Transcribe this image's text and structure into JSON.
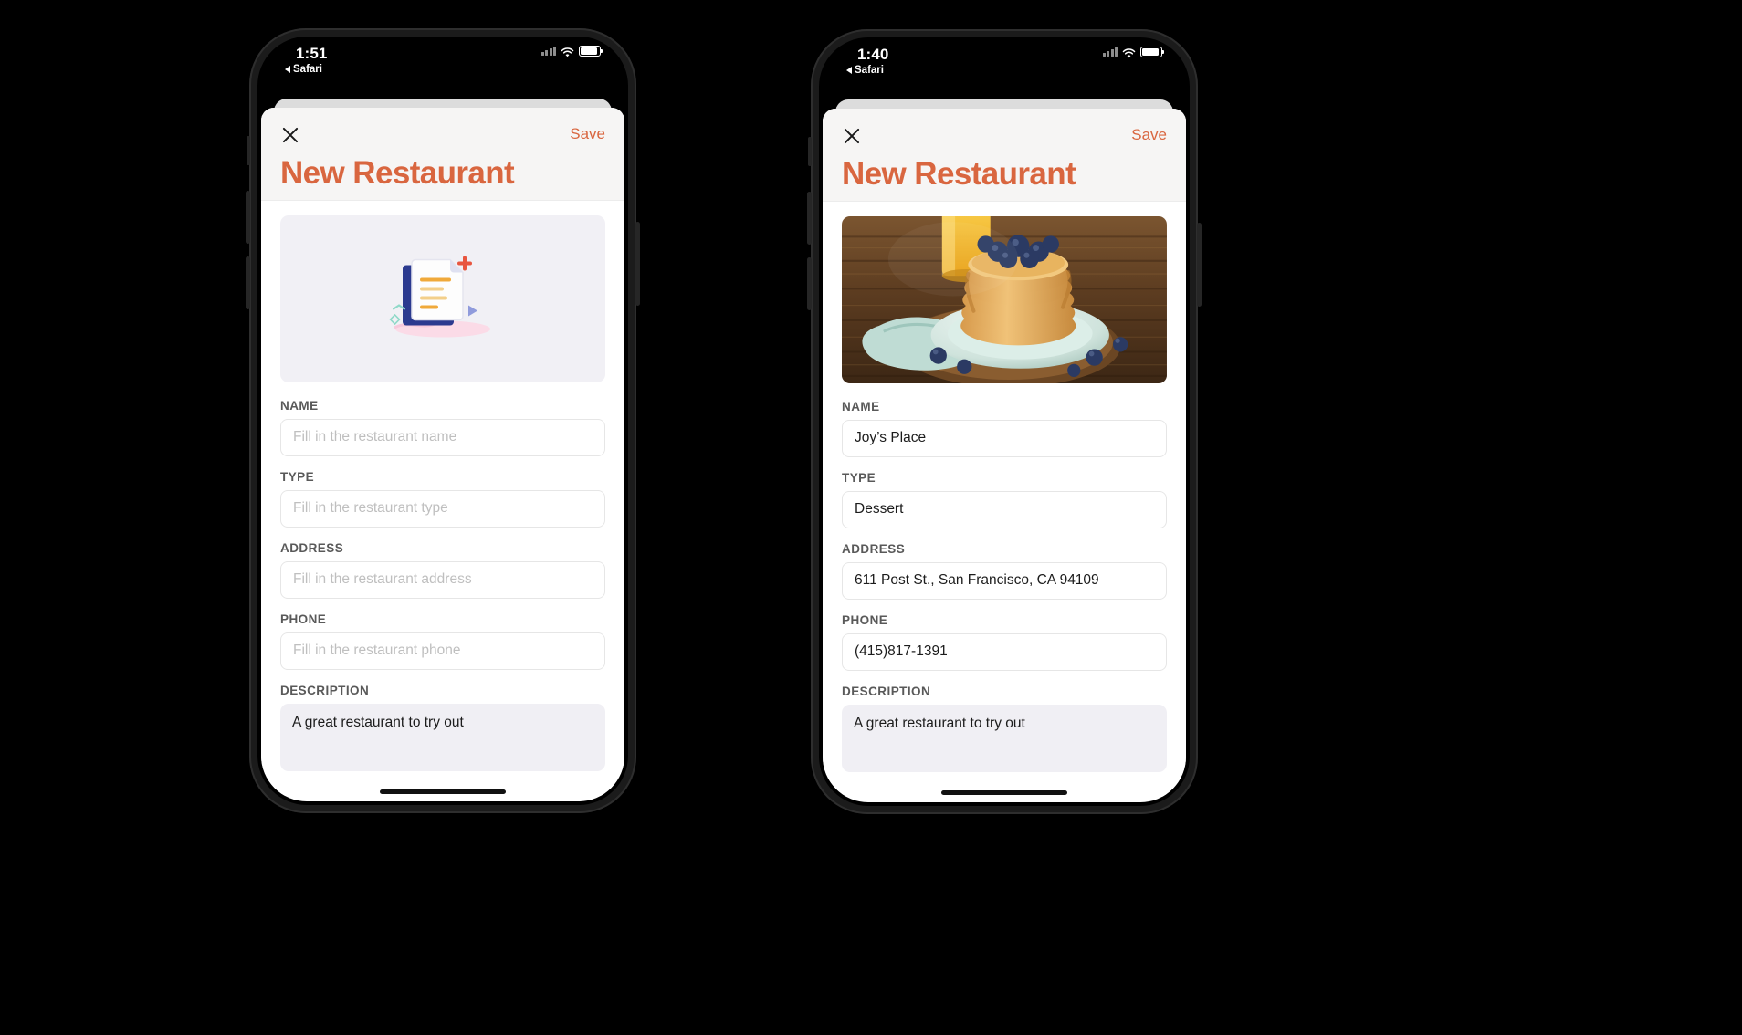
{
  "phones": [
    {
      "id": "empty-form",
      "status": {
        "time": "1:51",
        "back_app": "Safari",
        "back_arrow": "◀"
      },
      "header": {
        "close_icon": "close-icon",
        "save_label": "Save",
        "title": "New Restaurant"
      },
      "hero": {
        "kind": "placeholder-illustration",
        "alt": "add-photo-illustration"
      },
      "fields": [
        {
          "label": "NAME",
          "placeholder": "Fill in the restaurant name",
          "value": ""
        },
        {
          "label": "TYPE",
          "placeholder": "Fill in the restaurant type",
          "value": ""
        },
        {
          "label": "ADDRESS",
          "placeholder": "Fill in the restaurant address",
          "value": ""
        },
        {
          "label": "PHONE",
          "placeholder": "Fill in the restaurant phone",
          "value": ""
        }
      ],
      "description": {
        "label": "DESCRIPTION",
        "value": "A great restaurant to try out"
      }
    },
    {
      "id": "filled-form",
      "status": {
        "time": "1:40",
        "back_app": "Safari",
        "back_arrow": "◀"
      },
      "header": {
        "close_icon": "close-icon",
        "save_label": "Save",
        "title": "New Restaurant"
      },
      "hero": {
        "kind": "photo",
        "alt": "pancakes-with-blueberries-photo"
      },
      "fields": [
        {
          "label": "NAME",
          "placeholder": "Fill in the restaurant name",
          "value": "Joy’s Place"
        },
        {
          "label": "TYPE",
          "placeholder": "Fill in the restaurant type",
          "value": "Dessert"
        },
        {
          "label": "ADDRESS",
          "placeholder": "Fill in the restaurant address",
          "value": "611 Post St., San Francisco, CA 94109"
        },
        {
          "label": "PHONE",
          "placeholder": "Fill in the restaurant phone",
          "value": "(415)817-1391"
        }
      ],
      "description": {
        "label": "DESCRIPTION",
        "value": "A great restaurant to try out"
      }
    }
  ],
  "colors": {
    "accent": "#d9663f",
    "background": "#000000",
    "sheet": "#ffffff",
    "header_bg": "#f6f5f4",
    "label": "#595959",
    "placeholder": "#bfbfbf",
    "description_bg": "#f0eff4",
    "hero_placeholder_bg": "#f1f0f5"
  }
}
